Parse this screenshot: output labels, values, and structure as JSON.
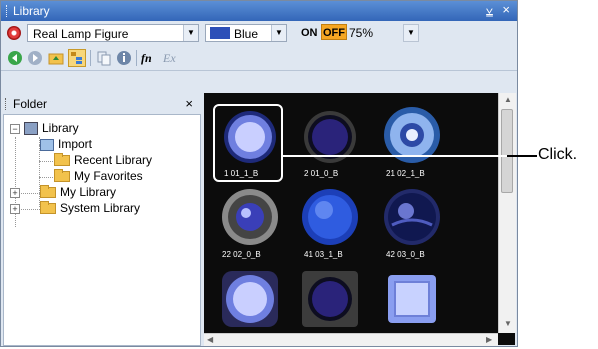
{
  "window": {
    "title": "Library",
    "pin_glyph": "⩣",
    "close_glyph": "×"
  },
  "toolbar_row1": {
    "figure_select": "Real Lamp Figure",
    "color_select": "Blue",
    "on_label": "ON",
    "off_label": "OFF",
    "zoom_select": "75%"
  },
  "toolbar_row2": {
    "icons": [
      "back-icon",
      "forward-icon",
      "folder-up-icon",
      "tree-view-icon",
      "copy-icon",
      "properties-icon",
      "fn-icon",
      "ex-icon"
    ],
    "fn_label": "fn",
    "ex_label": "Ex"
  },
  "folder_panel": {
    "title": "Folder",
    "close_glyph": "×",
    "tree": [
      {
        "label": "Library"
      },
      {
        "label": "Import"
      },
      {
        "label": "Recent Library"
      },
      {
        "label": "My Favorites"
      },
      {
        "label": "My Library"
      },
      {
        "label": "System Library"
      }
    ]
  },
  "gallery": {
    "items": [
      {
        "caption": "1 01_1_B"
      },
      {
        "caption": "2 01_0_B"
      },
      {
        "caption": "21 02_1_B"
      },
      {
        "caption": "22 02_0_B"
      },
      {
        "caption": "41 03_1_B"
      },
      {
        "caption": "42 03_0_B"
      },
      {
        "caption": ""
      },
      {
        "caption": ""
      },
      {
        "caption": ""
      }
    ]
  },
  "annotation": {
    "label": "Click."
  },
  "colors": {
    "accent": "#3366b8",
    "lamp_blue": "#2c4fb8",
    "off_badge": "#f5a623"
  }
}
